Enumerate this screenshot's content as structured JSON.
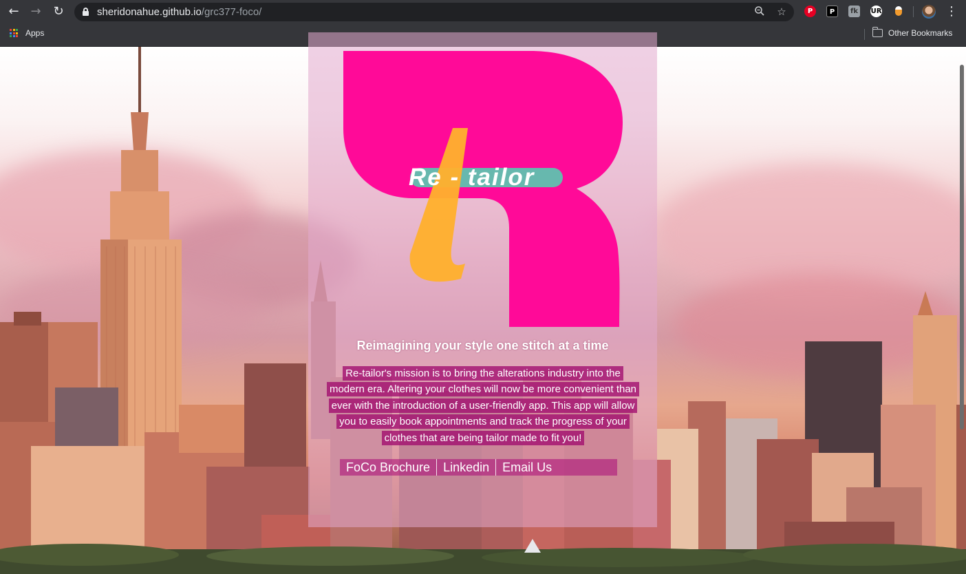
{
  "browser": {
    "url_host": "sheridonahue.github.io",
    "url_path": "/grc377-foco/",
    "bookmarks": {
      "apps_label": "Apps",
      "other_label": "Other Bookmarks"
    },
    "extension_icons": [
      "pinterest-icon",
      "p-extension-icon",
      "fk-extension-icon",
      "ur-extension-icon",
      "orange-extension-icon"
    ]
  },
  "page": {
    "logo_text": "Re - tailor",
    "tagline": "Reimagining your style one stitch at a time",
    "mission": "Re-tailor's mission is to bring the alterations industry into the modern era. Altering your clothes will now be more convenient than ever with the introduction of a user-friendly app. This app will allow you to easily book appointments and track the progress of your clothes that are being tailor made to fit you!",
    "links": [
      "FoCo Brochure",
      "Linkedin",
      "Email Us"
    ]
  },
  "colors": {
    "logo_magenta": "#ff0a98",
    "logo_orange": "#ffb02e",
    "logo_teal": "#67b8ae",
    "panel_tint": "#e2aacd"
  }
}
